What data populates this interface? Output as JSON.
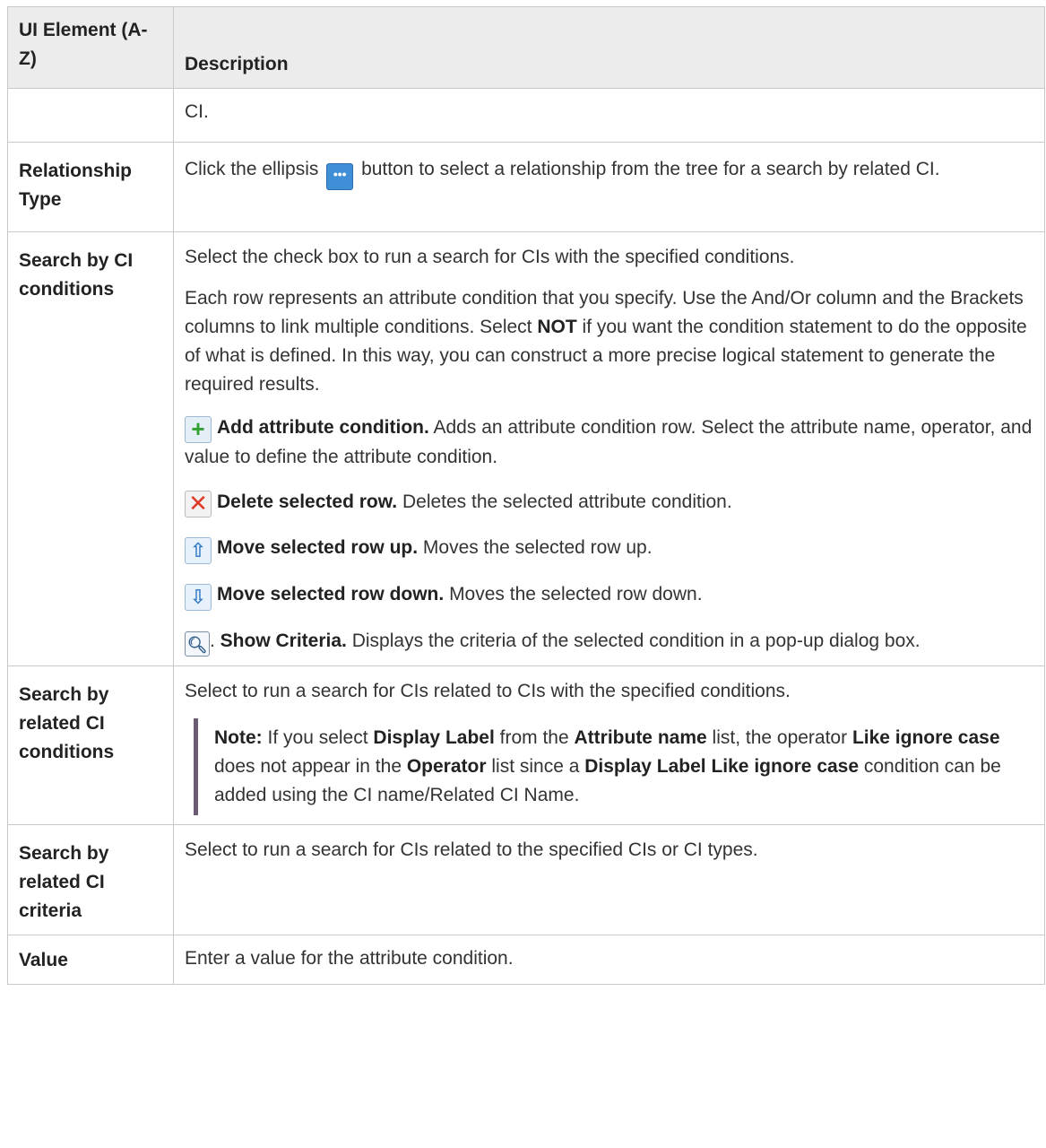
{
  "header": {
    "col1": "UI Element (A-Z)",
    "col2": "Description"
  },
  "rows": {
    "r0": {
      "desc": "CI."
    },
    "r1": {
      "name": "Relationship Type",
      "desc_before": "Click the ellipsis",
      "desc_after": "button to select a relationship from the tree for a search by related CI."
    },
    "r2": {
      "name": "Search by CI conditions",
      "p1": "Select the check box to run a search for CIs with the specified conditions.",
      "p2a": "Each row represents an attribute condition that you specify. Use the And/Or column and the Brackets columns to link multiple conditions. Select ",
      "p2b": "NOT",
      "p2c": " if you want the condition statement to do the opposite of what is defined. In this way, you can construct a more precise logical statement to generate the required results.",
      "add_label": "Add attribute condition.",
      "add_text": " Adds an attribute condition row. Select the attribute name, operator, and value to define the attribute condition.",
      "del_label": "Delete selected row.",
      "del_text": " Deletes the selected attribute condition.",
      "up_label": "Move selected row up.",
      "up_text": " Moves the selected row up.",
      "down_label": "Move selected row down.",
      "down_text": " Moves the selected row down.",
      "find_dot": ". ",
      "find_label": "Show Criteria.",
      "find_text": " Displays the criteria of the selected condition in a pop-up dialog box."
    },
    "r3": {
      "name": "Search by related CI conditions",
      "p1": "Select to run a search for CIs related to CIs with the specified conditions.",
      "note_label": "Note:",
      "n1": " If you select ",
      "n2": "Display Label",
      "n3": " from the ",
      "n4": "Attribute name",
      "n5": " list, the operator ",
      "n6": "Like ignore case",
      "n7": " does not appear in the ",
      "n8": "Operator",
      "n9": " list since a ",
      "n10": "Display Label Like ignore case",
      "n11": " condition can be added using the CI name/Related CI Name."
    },
    "r4": {
      "name": "Search by related CI criteria",
      "p1": "Select to run a search for CIs related to the specified CIs or CI types."
    },
    "r5": {
      "name": "Value",
      "p1": "Enter a value for the attribute condition."
    }
  },
  "icons": {
    "ellipsis": "ellipsis-icon",
    "add": "add-icon",
    "delete": "delete-icon",
    "up": "move-up-icon",
    "down": "move-down-icon",
    "find": "magnifier-icon"
  }
}
